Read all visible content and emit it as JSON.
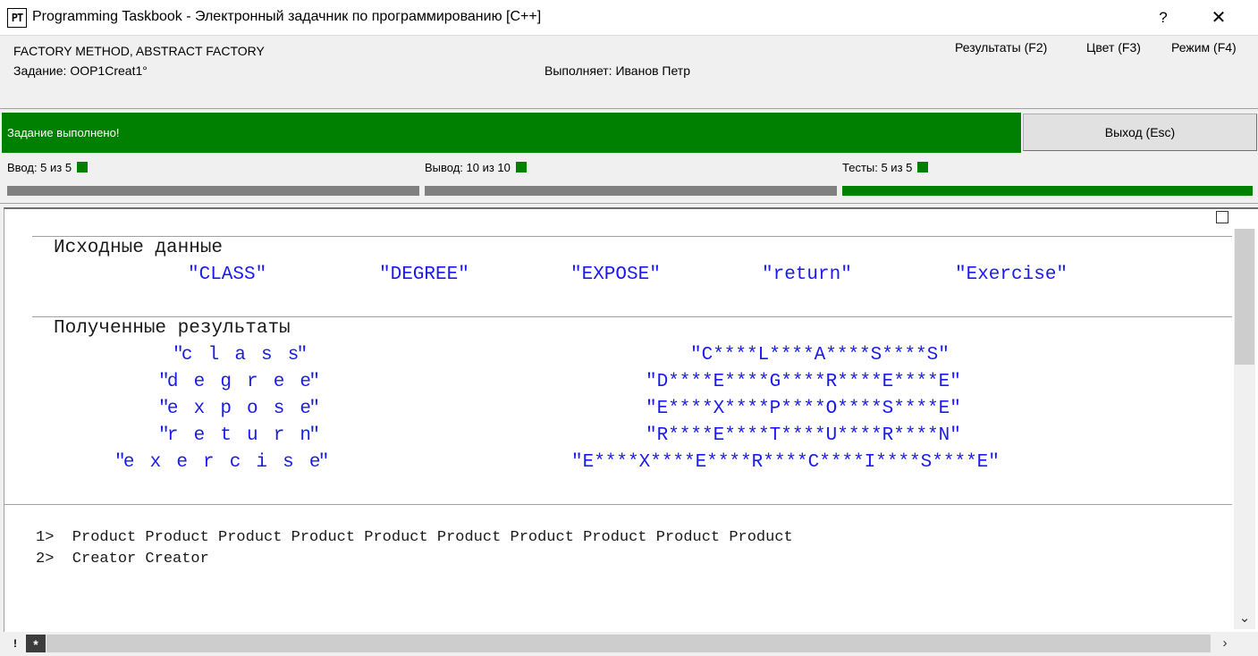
{
  "window": {
    "app_icon": "PT",
    "title": "Programming Taskbook - Электронный задачник по программированию [C++]",
    "help": "?",
    "close": "✕"
  },
  "header": {
    "task_group": "FACTORY METHOD, ABSTRACT FACTORY",
    "task": "Задание: OOP1Creat1°",
    "performer": "Выполняет: Иванов Петр",
    "menu": {
      "results": "Результаты (F2)",
      "color": "Цвет (F3)",
      "mode": "Режим (F4)"
    }
  },
  "status": {
    "message": "Задание выполнено!",
    "exit_label": "Выход (Esc)",
    "success_color": "#008000"
  },
  "counters": {
    "input": "Ввод:  5 из 5",
    "output": "Вывод:  10 из 10",
    "tests": "Тесты:  5 из 5",
    "input_progress": 1.0,
    "output_progress": 1.0,
    "tests_progress": 1.0
  },
  "source": {
    "heading": "Исходные данные",
    "values": [
      "\"CLASS\"",
      "\"DEGREE\"",
      "\"EXPOSE\"",
      "\"return\"",
      "\"Exercise\""
    ]
  },
  "results": {
    "heading": "Полученные результаты",
    "rows": [
      {
        "spaced": "\"c  l  a  s  s\"",
        "starred": "\"C****L****A****S****S\""
      },
      {
        "spaced": "\"d  e  g  r  e  e\"",
        "starred": "\"D****E****G****R****E****E\""
      },
      {
        "spaced": "\"e  x  p  o  s  e\"",
        "starred": "\"E****X****P****O****S****E\""
      },
      {
        "spaced": "\"r  e  t  u  r  n\"",
        "starred": "\"R****E****T****U****R****N\""
      },
      {
        "spaced": "\"e  x  e  r  c  i  s  e\"",
        "starred": "\"E****X****E****R****C****I****S****E\""
      }
    ]
  },
  "debug": {
    "lines": [
      "1>  Product Product Product Product Product Product Product Product Product Product",
      "2>  Creator Creator"
    ]
  },
  "bottom": {
    "excl": "!",
    "star": "*",
    "scroll_down": "⌄",
    "scroll_right": "›"
  }
}
